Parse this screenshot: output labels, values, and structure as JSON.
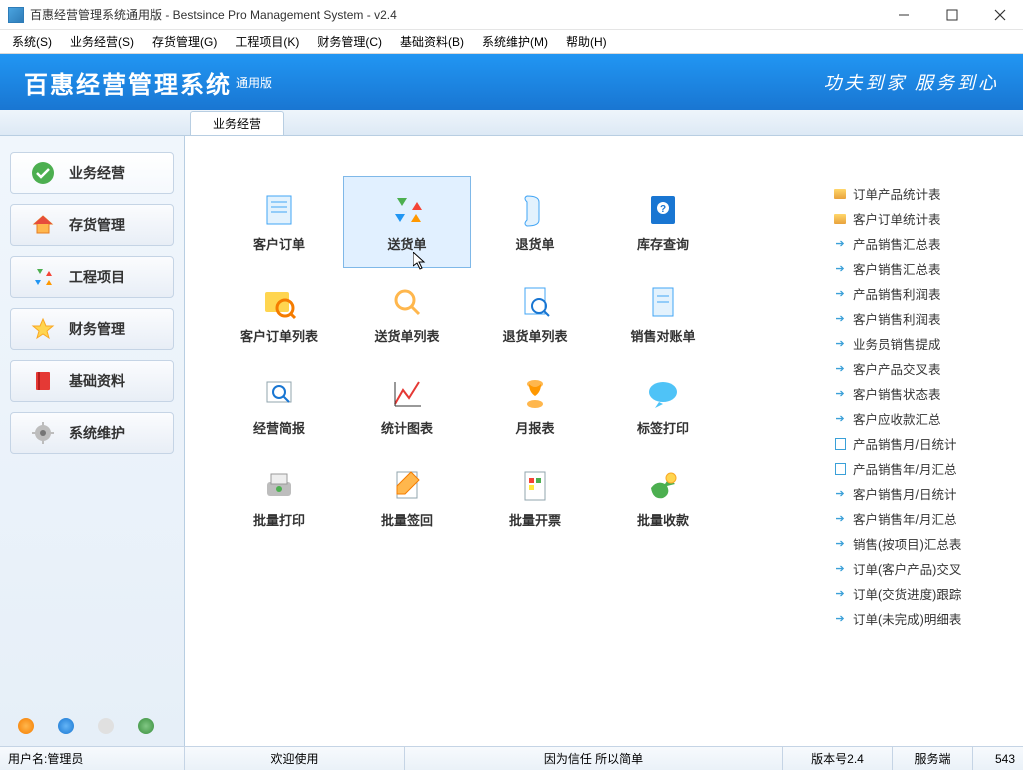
{
  "window": {
    "title": "百惠经营管理系统通用版 - Bestsince Pro Management System - v2.4"
  },
  "menus": [
    "系统(S)",
    "业务经营(S)",
    "存货管理(G)",
    "工程项目(K)",
    "财务管理(C)",
    "基础资料(B)",
    "系统维护(M)",
    "帮助(H)"
  ],
  "banner": {
    "title": "百惠经营管理系统",
    "sub": "通用版",
    "slogan": "功夫到家 服务到心"
  },
  "tab": {
    "label": "业务经营"
  },
  "sidebar": {
    "items": [
      {
        "label": "业务经营"
      },
      {
        "label": "存货管理"
      },
      {
        "label": "工程项目"
      },
      {
        "label": "财务管理"
      },
      {
        "label": "基础资料"
      },
      {
        "label": "系统维护"
      }
    ]
  },
  "grid": [
    {
      "label": "客户订单"
    },
    {
      "label": "送货单"
    },
    {
      "label": "退货单"
    },
    {
      "label": "库存查询"
    },
    {
      "label": "客户订单列表"
    },
    {
      "label": "送货单列表"
    },
    {
      "label": "退货单列表"
    },
    {
      "label": "销售对账单"
    },
    {
      "label": "经营简报"
    },
    {
      "label": "统计图表"
    },
    {
      "label": "月报表"
    },
    {
      "label": "标签打印"
    },
    {
      "label": "批量打印"
    },
    {
      "label": "批量签回"
    },
    {
      "label": "批量开票"
    },
    {
      "label": "批量收款"
    }
  ],
  "grid_selected": 1,
  "links": [
    {
      "icon": "folder",
      "label": "订单产品统计表"
    },
    {
      "icon": "folder",
      "label": "客户订单统计表"
    },
    {
      "icon": "arrow",
      "label": "产品销售汇总表"
    },
    {
      "icon": "arrow",
      "label": "客户销售汇总表"
    },
    {
      "icon": "arrow",
      "label": "产品销售利润表"
    },
    {
      "icon": "arrow",
      "label": "客户销售利润表"
    },
    {
      "icon": "arrow",
      "label": "业务员销售提成"
    },
    {
      "icon": "arrow",
      "label": "客户产品交叉表"
    },
    {
      "icon": "arrow",
      "label": "客户销售状态表"
    },
    {
      "icon": "arrow",
      "label": "客户应收款汇总"
    },
    {
      "icon": "doc",
      "label": "产品销售月/日统计"
    },
    {
      "icon": "doc",
      "label": "产品销售年/月汇总"
    },
    {
      "icon": "arrow",
      "label": "客户销售月/日统计"
    },
    {
      "icon": "arrow",
      "label": "客户销售年/月汇总"
    },
    {
      "icon": "arrow",
      "label": "销售(按项目)汇总表"
    },
    {
      "icon": "arrow",
      "label": "订单(客户产品)交叉"
    },
    {
      "icon": "arrow",
      "label": "订单(交货进度)跟踪"
    },
    {
      "icon": "arrow",
      "label": "订单(未完成)明细表"
    }
  ],
  "status": {
    "user_label": "用户名:管理员",
    "welcome": "欢迎使用",
    "motto": "因为信任 所以简单",
    "version": "版本号2.4",
    "server": "服务端",
    "count": "543"
  }
}
